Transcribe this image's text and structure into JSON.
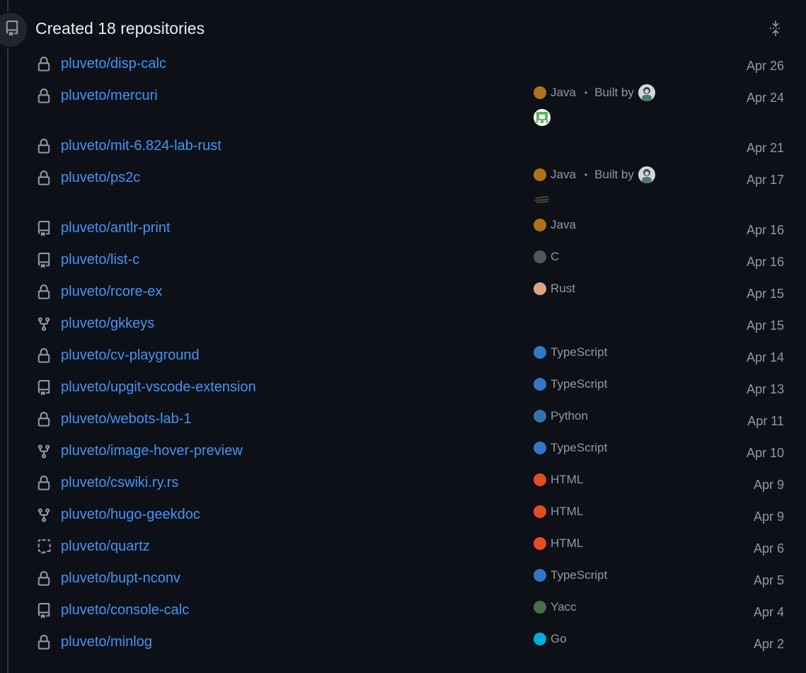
{
  "header": {
    "title": "Created 18 repositories"
  },
  "colors": {
    "link": "#4493f8",
    "muted": "#9198a1",
    "Java": "#b07219",
    "C": "#555555",
    "Rust": "#dea584",
    "TypeScript": "#3178c6",
    "Python": "#3572A5",
    "HTML": "#e34c26",
    "Yacc": "#4B6C4B",
    "Go": "#00ADD8"
  },
  "repos": [
    {
      "name": "pluveto/disp-calc",
      "icon": "lock-icon",
      "language": "",
      "date": "Apr 26"
    },
    {
      "name": "pluveto/mercuri",
      "icon": "lock-icon",
      "language": "Java",
      "built_by": "Built by",
      "date": "Apr 24"
    },
    {
      "name": "pluveto/mit-6.824-lab-rust",
      "icon": "lock-icon",
      "language": "",
      "date": "Apr 21"
    },
    {
      "name": "pluveto/ps2c",
      "icon": "lock-icon",
      "language": "Java",
      "built_by": "Built by",
      "date": "Apr 17"
    },
    {
      "name": "pluveto/antlr-print",
      "icon": "repo-icon",
      "language": "Java",
      "date": "Apr 16"
    },
    {
      "name": "pluveto/list-c",
      "icon": "repo-icon",
      "language": "C",
      "date": "Apr 16"
    },
    {
      "name": "pluveto/rcore-ex",
      "icon": "lock-icon",
      "language": "Rust",
      "date": "Apr 15"
    },
    {
      "name": "pluveto/gkkeys",
      "icon": "fork-icon",
      "language": "",
      "date": "Apr 15"
    },
    {
      "name": "pluveto/cv-playground",
      "icon": "lock-icon",
      "language": "TypeScript",
      "date": "Apr 14"
    },
    {
      "name": "pluveto/upgit-vscode-extension",
      "icon": "repo-icon",
      "language": "TypeScript",
      "date": "Apr 13"
    },
    {
      "name": "pluveto/webots-lab-1",
      "icon": "lock-icon",
      "language": "Python",
      "date": "Apr 11"
    },
    {
      "name": "pluveto/image-hover-preview",
      "icon": "fork-icon",
      "language": "TypeScript",
      "date": "Apr 10"
    },
    {
      "name": "pluveto/cswiki.ry.rs",
      "icon": "lock-icon",
      "language": "HTML",
      "date": "Apr 9"
    },
    {
      "name": "pluveto/hugo-geekdoc",
      "icon": "fork-icon",
      "language": "HTML",
      "date": "Apr 9"
    },
    {
      "name": "pluveto/quartz",
      "icon": "template-icon",
      "language": "HTML",
      "date": "Apr 6"
    },
    {
      "name": "pluveto/bupt-nconv",
      "icon": "lock-icon",
      "language": "TypeScript",
      "date": "Apr 5"
    },
    {
      "name": "pluveto/console-calc",
      "icon": "repo-icon",
      "language": "Yacc",
      "date": "Apr 4"
    },
    {
      "name": "pluveto/minlog",
      "icon": "lock-icon",
      "language": "Go",
      "date": "Apr 2"
    }
  ]
}
